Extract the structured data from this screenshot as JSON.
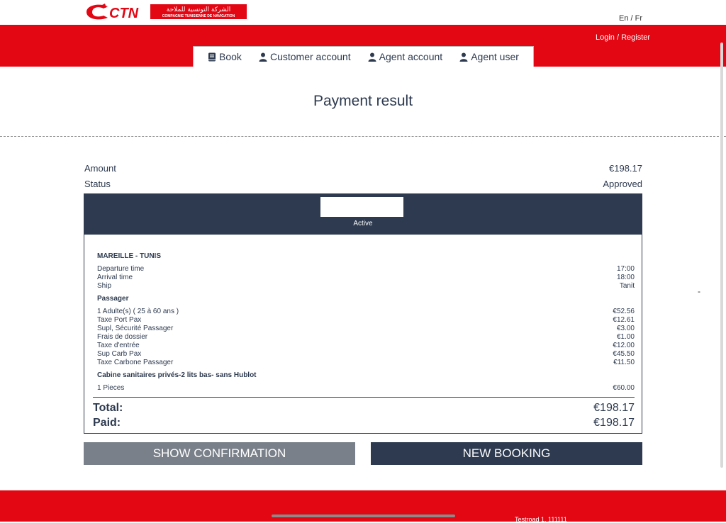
{
  "brand": {
    "logo_text": "CTN",
    "logo_arabic": "الشركة التونسية للملاحة",
    "logo_subtitle": "COMPAGNIE TUNISIENNE DE NAVIGATION",
    "primary_color": "#e30613",
    "dark_color": "#2d3a4f"
  },
  "header": {
    "lang": "En / Fr",
    "login": "Login / Register"
  },
  "nav": [
    {
      "label": "Book",
      "icon": "book-icon"
    },
    {
      "label": "Customer account",
      "icon": "user-icon"
    },
    {
      "label": "Agent account",
      "icon": "user-icon"
    },
    {
      "label": "Agent user",
      "icon": "user-icon"
    }
  ],
  "page": {
    "title": "Payment result"
  },
  "summary": {
    "amount_label": "Amount",
    "amount_value": "€198.17",
    "status_label": "Status",
    "status_value": "Approved"
  },
  "ticket": {
    "status": "Active",
    "route": "MAREILLE - TUNIS",
    "departure_label": "Departure time",
    "departure_value": "17:00",
    "arrival_label": "Arrival time",
    "arrival_value": "18:00",
    "ship_label": "Ship",
    "ship_value": "Tanit",
    "passenger_section": "Passager",
    "passenger_items": [
      {
        "label": "1 Adulte(s) ( 25 à 60 ans )",
        "value": "€52.56"
      },
      {
        "label": "Taxe Port Pax",
        "value": "€12.61"
      },
      {
        "label": "Supl, Sécurité Passager",
        "value": "€3.00"
      },
      {
        "label": "Frais de dossier",
        "value": "€1.00"
      },
      {
        "label": "Taxe d'entrée",
        "value": "€12.00"
      },
      {
        "label": "Sup Carb Pax",
        "value": "€45.50"
      },
      {
        "label": "Taxe Carbone Passager",
        "value": "€11.50"
      }
    ],
    "cabin_section": "Cabine sanitaires privés-2 lits bas- sans Hublot",
    "cabin_items": [
      {
        "label": "1 Pieces",
        "value": "€60.00"
      }
    ],
    "total_label": "Total:",
    "total_value": "€198.17",
    "paid_label": "Paid:",
    "paid_value": "€198.17"
  },
  "buttons": {
    "confirm": "SHOW CONFIRMATION",
    "new_booking": "NEW BOOKING"
  },
  "side_mark": "-",
  "footer": {
    "address": "Testroad 1, 111111"
  }
}
